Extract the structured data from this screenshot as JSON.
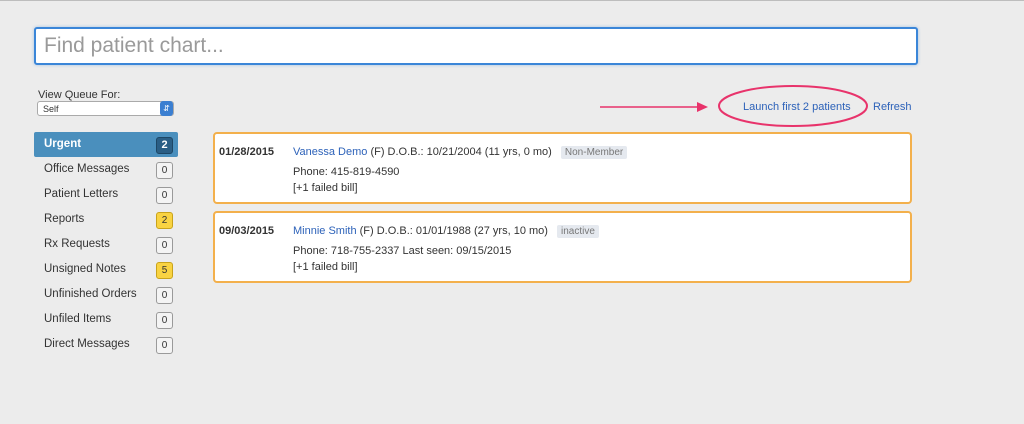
{
  "search": {
    "placeholder": "Find patient chart..."
  },
  "queue": {
    "label": "View Queue For:",
    "selected": "Self"
  },
  "sidebar": {
    "items": [
      {
        "label": "Urgent",
        "count": "2",
        "style": "active"
      },
      {
        "label": "Office Messages",
        "count": "0",
        "style": "plain"
      },
      {
        "label": "Patient Letters",
        "count": "0",
        "style": "plain"
      },
      {
        "label": "Reports",
        "count": "2",
        "style": "yellow"
      },
      {
        "label": "Rx Requests",
        "count": "0",
        "style": "plain"
      },
      {
        "label": "Unsigned Notes",
        "count": "5",
        "style": "yellow"
      },
      {
        "label": "Unfinished Orders",
        "count": "0",
        "style": "plain"
      },
      {
        "label": "Unfiled Items",
        "count": "0",
        "style": "plain"
      },
      {
        "label": "Direct Messages",
        "count": "0",
        "style": "plain"
      }
    ]
  },
  "actions": {
    "launch": "Launch first 2 patients",
    "refresh": "Refresh"
  },
  "patients": [
    {
      "date": "01/28/2015",
      "name": "Vanessa Demo",
      "details": "(F)  D.O.B.: 10/21/2004 (11 yrs, 0 mo)",
      "tag": "Non-Member",
      "phone": "Phone: 415-819-4590",
      "bill": "[+1 failed bill]"
    },
    {
      "date": "09/03/2015",
      "name": "Minnie Smith",
      "details": "(F)  D.O.B.: 01/01/1988 (27 yrs, 10 mo)",
      "tag": "inactive",
      "phone": "Phone: 718-755-2337   Last seen: 09/15/2015",
      "bill": "[+1 failed bill]"
    }
  ],
  "colors": {
    "accent": "#3b86d8",
    "link": "#2d62b9",
    "card_border": "#f3b04c",
    "annotation": "#e8336b"
  }
}
